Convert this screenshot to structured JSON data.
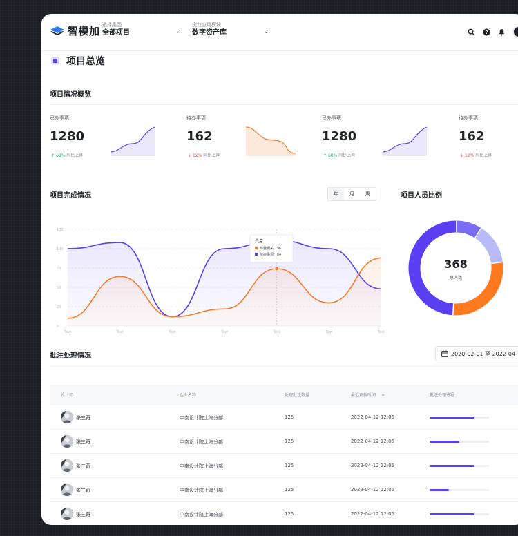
{
  "app": {
    "name": "智模加",
    "org_caption": "选择集团",
    "org_value": "全部项目",
    "module_caption": "企业应用模块",
    "module_value": "数字资产库"
  },
  "page_title": "项目总览",
  "overview": {
    "title": "项目情况概览",
    "stats": [
      {
        "label": "已办事项",
        "value": "1280",
        "pct": "68%",
        "suffix": "同比上月",
        "direction": "up",
        "arrow": "↑"
      },
      {
        "label": "待办事项",
        "value": "162",
        "pct": "12%",
        "suffix": "同比上月",
        "direction": "down",
        "arrow": "↓"
      },
      {
        "label": "已办事项",
        "value": "1280",
        "pct": "68%",
        "suffix": "同比上月",
        "direction": "up",
        "arrow": "↑"
      },
      {
        "label": "待办事项",
        "value": "162",
        "pct": "12%",
        "suffix": "同比上月",
        "direction": "down",
        "arrow": "↓"
      }
    ]
  },
  "completion": {
    "title": "项目完成情况",
    "tabs": [
      "年",
      "月",
      "周"
    ],
    "active_tab": 0,
    "tooltip": {
      "title": "六月",
      "items": [
        {
          "label": "与我相关:",
          "value": "96",
          "color": "#f57c2a"
        },
        {
          "label": "待办事项:",
          "value": "84",
          "color": "#5b3ff2"
        }
      ]
    }
  },
  "chart_data": {
    "type": "line",
    "x": [
      "Text",
      "Text",
      "Text",
      "Text",
      "Text",
      "Text",
      "Text"
    ],
    "yticks": [
      0,
      25,
      50,
      75,
      100,
      125
    ],
    "ylim": [
      0,
      125
    ],
    "series": [
      {
        "color": "#5b3ff2",
        "values": [
          100,
          108,
          12,
          100,
          111,
          100,
          48
        ]
      },
      {
        "color": "#f57c2a",
        "values": [
          10,
          64,
          12,
          22,
          74,
          30,
          88
        ]
      }
    ]
  },
  "ratio": {
    "title": "项目人员比例",
    "total": "368",
    "total_label": "总人数",
    "segments": [
      {
        "value": 0.09,
        "color": "#7b6cf6"
      },
      {
        "value": 0.14,
        "color": "#b8bbf7"
      },
      {
        "value": 0.28,
        "color": "#ff7a1f"
      },
      {
        "value": 0.49,
        "color": "#5b3ff2"
      }
    ]
  },
  "annotations": {
    "title": "批注处理情况",
    "date_range": "2020-02-01 至 2022-04-",
    "columns": [
      "设计师",
      "企业名称",
      "处理批注数量",
      "最近更新时间",
      "批注处理进程"
    ],
    "sort_glyph": "≑",
    "rows": [
      {
        "name": "张三奇",
        "company": "中南设计院上海分部",
        "count": "125",
        "updated": "2022-04-12 12:05",
        "progress": 0.75
      },
      {
        "name": "张三奇",
        "company": "中南设计院上海分部",
        "count": "125",
        "updated": "2022-04-12 12:05",
        "progress": 0.5
      },
      {
        "name": "张三奇",
        "company": "中南设计院上海分部",
        "count": "125",
        "updated": "2022-04-12 12:05",
        "progress": 0.75
      },
      {
        "name": "张三奇",
        "company": "中南设计院上海分部",
        "count": "125",
        "updated": "2022-04-12 12:05",
        "progress": 0.32
      },
      {
        "name": "张三奇",
        "company": "中南设计院上海分部",
        "count": "125",
        "updated": "2022-04-12 12:05",
        "progress": 0.75
      }
    ]
  }
}
